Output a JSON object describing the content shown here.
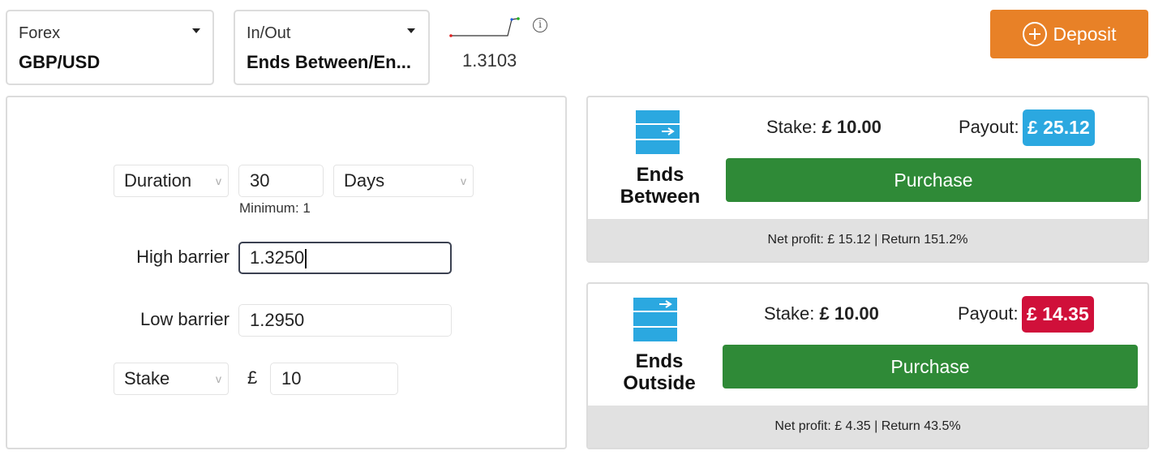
{
  "header": {
    "market": {
      "category": "Forex",
      "value": "GBP/USD"
    },
    "contract_type": {
      "category": "In/Out",
      "value": "Ends Between/En..."
    },
    "spot_price": "1.3103",
    "info_glyph": "i",
    "deposit_label": "Deposit"
  },
  "form": {
    "duration_mode": "Duration",
    "duration_value": "30",
    "duration_unit": "Days",
    "duration_hint": "Minimum: 1",
    "high_barrier_label": "High barrier",
    "high_barrier_value": "1.3250",
    "low_barrier_label": "Low barrier",
    "low_barrier_value": "1.2950",
    "amount_mode": "Stake",
    "currency_symbol": "£",
    "amount_value": "10"
  },
  "contracts": [
    {
      "name": "Ends Between",
      "stake_label": "Stake:",
      "stake_value": "£ 10.00",
      "payout_label": "Payout:",
      "payout_value": "£ 25.12",
      "payout_color": "#2ba8e0",
      "purchase_label": "Purchase",
      "footer": "Net profit: £ 15.12 | Return 151.2%",
      "icon": "ends-between-icon"
    },
    {
      "name": "Ends Outside",
      "stake_label": "Stake:",
      "stake_value": "£ 10.00",
      "payout_label": "Payout:",
      "payout_value": "£ 14.35",
      "payout_color": "#d0103a",
      "purchase_label": "Purchase",
      "footer": "Net profit: £ 4.35 | Return 43.5%",
      "icon": "ends-outside-icon"
    }
  ],
  "colors": {
    "deposit": "#e88127",
    "purchase": "#2f8a37",
    "icon_blue": "#2ba8e0"
  }
}
